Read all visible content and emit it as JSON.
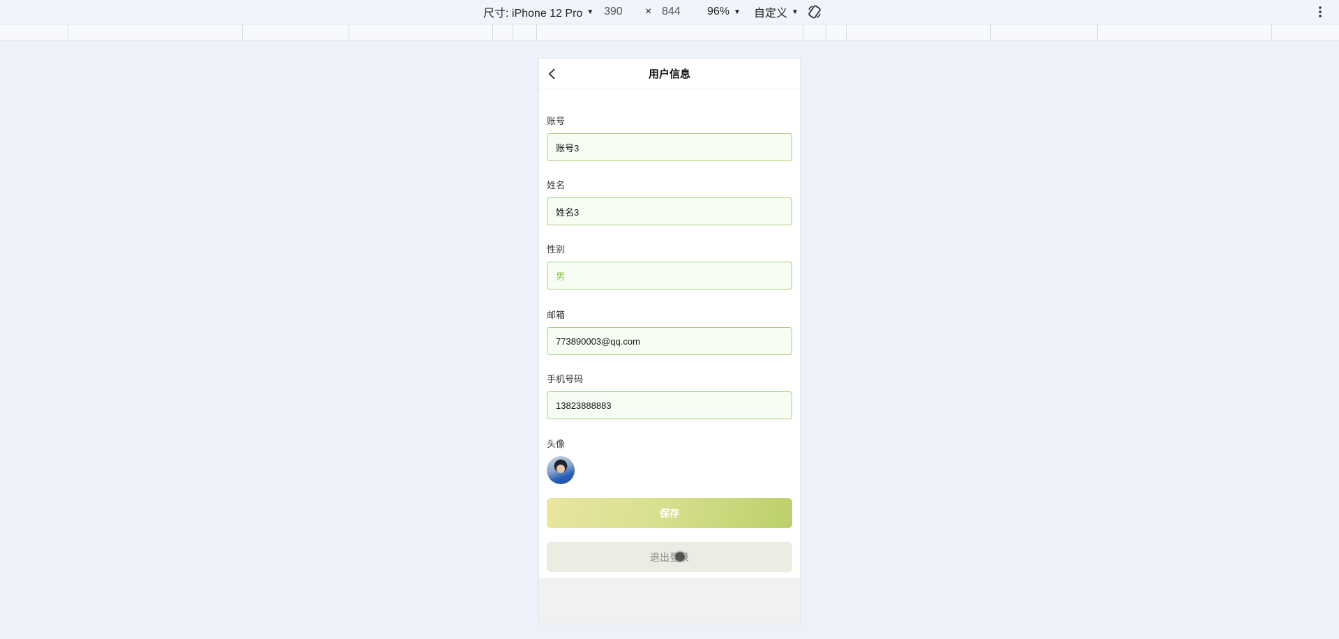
{
  "devtools": {
    "device_label": "尺寸: iPhone 12 Pro",
    "width": "390",
    "times": "×",
    "height": "844",
    "zoom": "96%",
    "throttle": "自定义",
    "rotate_icon": "rotate-icon",
    "more_icon": "more-vertical-icon",
    "caret": "▼"
  },
  "page": {
    "title": "用户信息",
    "back_icon": "chevron-left-icon"
  },
  "form": {
    "account": {
      "label": "账号",
      "value": "账号3"
    },
    "name": {
      "label": "姓名",
      "value": "姓名3"
    },
    "gender": {
      "label": "性别",
      "value": "男"
    },
    "email": {
      "label": "邮箱",
      "value": "773890003@qq.com"
    },
    "phone": {
      "label": "手机号码",
      "value": "13823888883"
    },
    "avatar": {
      "label": "头像"
    }
  },
  "buttons": {
    "save": "保存",
    "logout": "退出登录"
  },
  "colors": {
    "input_border": "#a8cf7e",
    "input_bg": "#f7fdf3",
    "save_gradient_start": "#e8e59f",
    "save_gradient_end": "#bcd06a",
    "logout_bg": "#ebece2"
  }
}
